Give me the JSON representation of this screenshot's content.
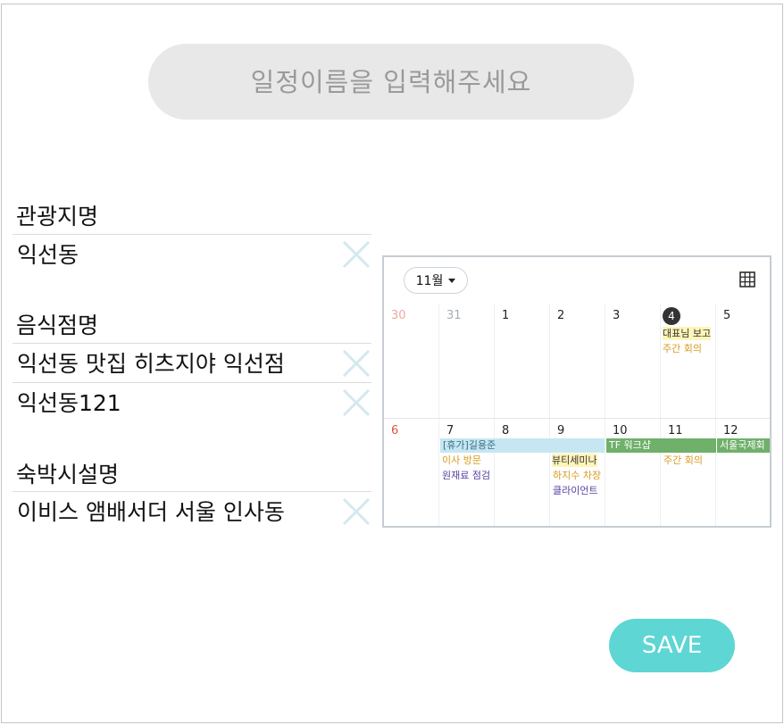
{
  "title_input": {
    "placeholder": "일정이름을 입력해주세요"
  },
  "sections": {
    "tourism": {
      "label": "관광지명",
      "values": [
        "익선동"
      ]
    },
    "restaurant": {
      "label": "음식점명",
      "values": [
        "익선동 맛집 히츠지야 익선점",
        "익선동121"
      ]
    },
    "lodging": {
      "label": "숙박시설명",
      "values": [
        "이비스 앰배서더 서울 인사동"
      ]
    }
  },
  "calendar": {
    "month_label": "11월",
    "week1": [
      "30",
      "31",
      "1",
      "2",
      "3",
      "4",
      "5"
    ],
    "week2": [
      "6",
      "7",
      "8",
      "9",
      "10",
      "11",
      "12"
    ],
    "events": {
      "e1": "대표님 보고",
      "e2": "주간 회의",
      "e3": "[휴가]길용준",
      "e4": "TF 워크샵",
      "e5": "서울국제회",
      "e6": "이사 방문",
      "e7": "뷰티세미나",
      "e8": "주간 회의",
      "e9": "원재료 점검",
      "e10": "하지수 차장",
      "e11": "클라이언트"
    }
  },
  "save_label": "SAVE",
  "colors": {
    "accent": "#5ed6d4",
    "clear_icon": "#d3e9ee",
    "title_bg": "#e8e8e8",
    "event_yellow": "#d99a1e",
    "event_purple": "#5a3fa0",
    "event_blue_bg": "#c6e6f2",
    "event_green_bg": "#6fb06a"
  },
  "icons": {
    "clear": "close-icon",
    "grid": "grid-view-icon",
    "dropdown": "caret-down-icon"
  }
}
